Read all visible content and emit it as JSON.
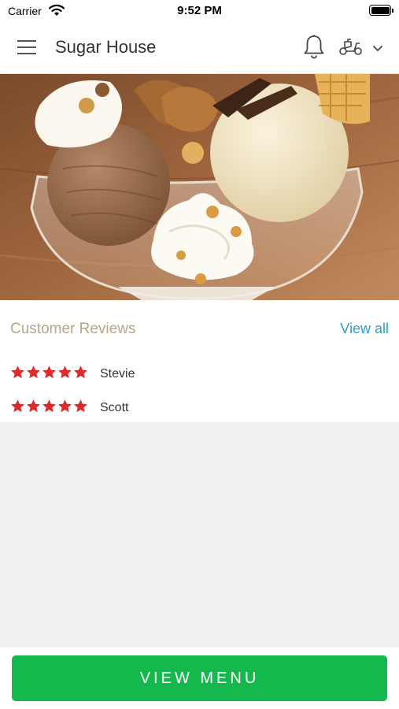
{
  "status": {
    "carrier": "Carrier",
    "time": "9:52 PM"
  },
  "header": {
    "title": "Sugar House"
  },
  "icons": {
    "menu": "menu-icon",
    "notifications": "bell-icon",
    "order_mode": "scooter-icon",
    "dropdown": "chevron-down-icon",
    "rating": "star-icon"
  },
  "reviews": {
    "title": "Customer Reviews",
    "view_all": "View all",
    "items": [
      {
        "name": "Stevie",
        "rating": 5
      },
      {
        "name": "Scott",
        "rating": 5
      }
    ]
  },
  "actions": {
    "view_menu": "VIEW MENU"
  },
  "colors": {
    "star": "#db2b2b",
    "primary_button": "#15b84c",
    "link": "#2f9fd0",
    "section_title": "#b2a68b"
  }
}
